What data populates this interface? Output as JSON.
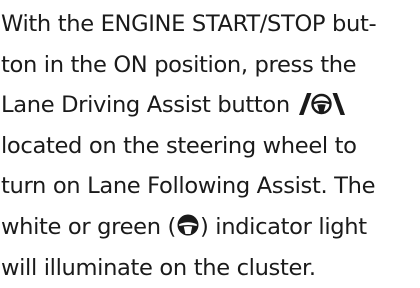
{
  "paragraph": {
    "line1": "With the ENGINE START/STOP but-",
    "line2": "ton in the ON position, press the",
    "line3_before": "Lane Driving Assist button",
    "line4": "located on the steering wheel to",
    "line5": "turn on Lane Following Assist. The",
    "line6_before": "white or green (",
    "line6_after": ") indicator light",
    "line7": "will illuminate on the cluster."
  },
  "icons": {
    "button_icon": "lane-driving-assist-button-icon",
    "indicator_icon": "lane-following-assist-indicator-icon"
  }
}
